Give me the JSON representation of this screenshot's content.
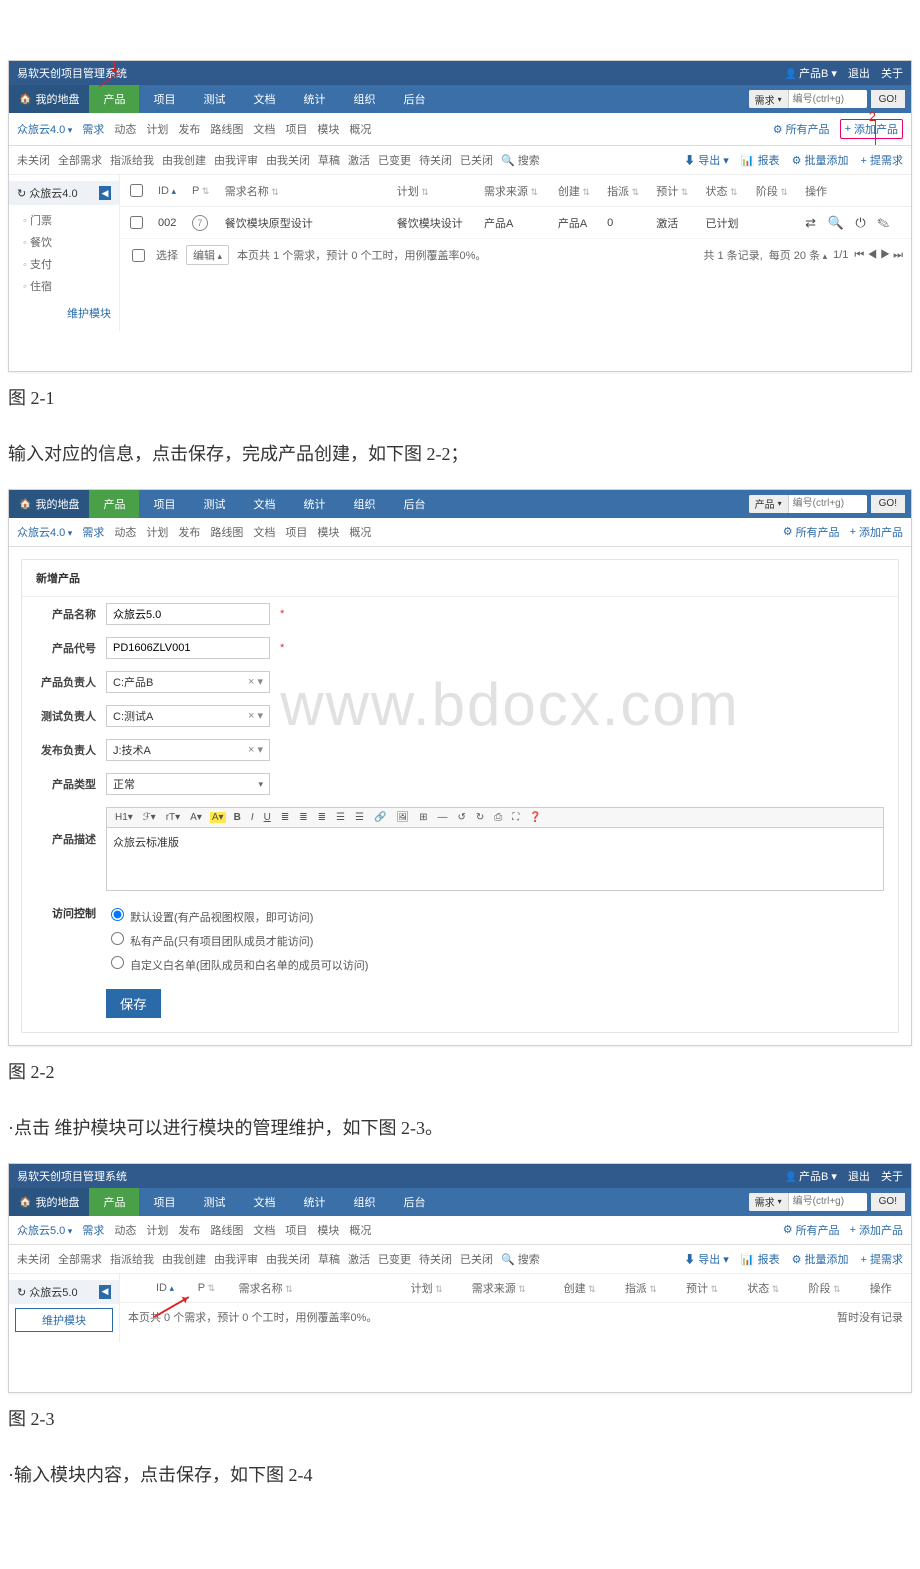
{
  "captions": {
    "c1": "图 2-1",
    "c2": "图 2-2",
    "c3": "图 2-3"
  },
  "texts": {
    "t1": "输入对应的信息，点击保存，完成产品创建，如下图 2-2；",
    "t2": "·点击 维护模块可以进行模块的管理维护，如下图 2-3。",
    "t3": "·输入模块内容，点击保存，如下图 2-4"
  },
  "annotation": {
    "n1": "1",
    "n2": "2"
  },
  "watermark": "www.bdocx.com",
  "common": {
    "brand_title": "易软天创项目管理系统",
    "user_label": "产品B",
    "logout": "退出",
    "about": "关于",
    "home": "我的地盘",
    "mainnav": [
      "产品",
      "项目",
      "测试",
      "文档",
      "统计",
      "组织",
      "后台"
    ],
    "search_type_req": "需求",
    "search_type_prod": "产品",
    "search_placeholder": "编号(ctrl+g)",
    "go": "GO!",
    "all_products": "所有产品",
    "add_product": "添加产品",
    "cog_icon": "⚙"
  },
  "shot1": {
    "crumb": "众旅云4.0",
    "subtabs": [
      "需求",
      "动态",
      "计划",
      "发布",
      "路线图",
      "文档",
      "项目",
      "模块",
      "概况"
    ],
    "subtab_active": 0,
    "filters": [
      "未关闭",
      "全部需求",
      "指派给我",
      "由我创建",
      "由我评审",
      "由我关闭",
      "草稿",
      "激活",
      "已变更",
      "待关闭",
      "已关闭",
      "搜索"
    ],
    "filter_search_icon": "🔍",
    "rside": {
      "export": "导出",
      "report": "报表",
      "batch_add": "批量添加",
      "add_req": "提需求",
      "export_icon": "⬇",
      "report_icon": "📊",
      "batch_icon": "⚙",
      "add_icon": "+"
    },
    "sidebar_head": "众旅云4.0",
    "sidebar_head_icon": "↻",
    "collapse_icon": "◀",
    "sidebar_items": [
      "门票",
      "餐饮",
      "支付",
      "住宿"
    ],
    "sidebar_foot": "维护模块",
    "cols": {
      "id": "ID",
      "p": "P",
      "name": "需求名称",
      "plan": "计划",
      "source": "需求来源",
      "creator": "创建",
      "assign": "指派",
      "est": "预计",
      "status": "状态",
      "stage": "阶段",
      "ops": "操作"
    },
    "row": {
      "chk": "",
      "id": "002",
      "p": "⑦",
      "name": "餐饮模块原型设计",
      "plan": "餐饮模块设计",
      "source": "产品A",
      "creator": "产品A",
      "assign": "0",
      "est": "激活",
      "status": "已计划",
      "stage": "",
      "ops": "⇄ 🔍 ⏻ ✎"
    },
    "footer": {
      "select_all": "选择",
      "edit": "编辑",
      "summary": "本页共 1 个需求，预计 0 个工时，用例覆盖率0%。",
      "total": "共 1 条记录,",
      "perpage": "每页 20 条",
      "page": "1/1",
      "nav": "⏮ ◀ ▶ ⏭"
    }
  },
  "shot2": {
    "crumb": "众旅云4.0",
    "subtabs": [
      "需求",
      "动态",
      "计划",
      "发布",
      "路线图",
      "文档",
      "项目",
      "模块",
      "概况"
    ],
    "form_title": "新增产品",
    "labels": {
      "name": "产品名称",
      "code": "产品代号",
      "owner": "产品负责人",
      "tester": "测试负责人",
      "release": "发布负责人",
      "type": "产品类型",
      "desc": "产品描述",
      "access": "访问控制"
    },
    "values": {
      "name": "众旅云5.0",
      "code": "PD1606ZLV001",
      "owner": "C:产品B",
      "tester": "C:测试A",
      "release": "J:技术A",
      "type": "正常",
      "desc": "众旅云标准版"
    },
    "rte": [
      "H1▾",
      "ℱ▾",
      "rT▾",
      "A▾",
      "A▾",
      "B",
      "I",
      "U",
      "≣",
      "≣",
      "≣",
      "☰",
      "☰",
      "🔗",
      "🖼",
      "⊞",
      "—",
      "↺",
      "↻",
      "⎙",
      "⛶",
      "❓"
    ],
    "access_opts": [
      "默认设置(有产品视图权限，即可访问)",
      "私有产品(只有项目团队成员才能访问)",
      "自定义白名单(团队成员和白名单的成员可以访问)"
    ],
    "save": "保存"
  },
  "shot3": {
    "crumb": "众旅云5.0",
    "subtabs": [
      "需求",
      "动态",
      "计划",
      "发布",
      "路线图",
      "文档",
      "项目",
      "模块",
      "概况"
    ],
    "filters": [
      "未关闭",
      "全部需求",
      "指派给我",
      "由我创建",
      "由我评审",
      "由我关闭",
      "草稿",
      "激活",
      "已变更",
      "待关闭",
      "已关闭",
      "搜索"
    ],
    "rside": {
      "export": "导出",
      "report": "报表",
      "batch_add": "批量添加",
      "add_req": "提需求"
    },
    "sidebar_head": "众旅云5.0",
    "sidebar_foot": "维护模块",
    "cols": {
      "id": "ID",
      "p": "P",
      "name": "需求名称",
      "plan": "计划",
      "source": "需求来源",
      "creator": "创建",
      "assign": "指派",
      "est": "预计",
      "status": "状态",
      "stage": "阶段",
      "ops": "操作"
    },
    "summary": "本页共 0 个需求，预计 0 个工时，用例覆盖率0%。",
    "nodata": "暂时没有记录"
  }
}
